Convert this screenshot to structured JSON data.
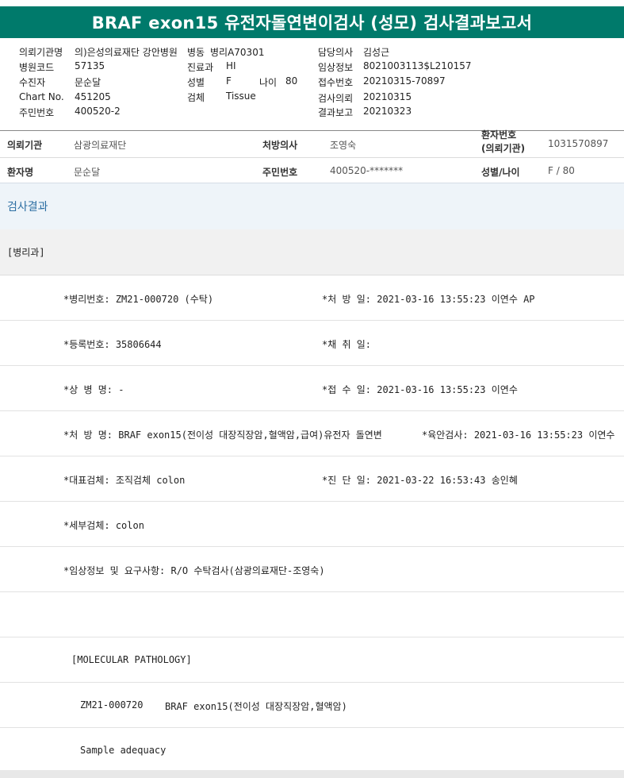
{
  "title": "BRAF exon15 유전자돌연변이검사 (성모) 검사결과보고서",
  "header": {
    "req_org_label": "의뢰기관명",
    "req_org_value": "의)은성의료재단 강안병원",
    "ward_label": "병동",
    "ward_value": "병리A70301",
    "doctor_label": "담당의사",
    "doctor_value": "김성근",
    "hosp_code_label": "병원코드",
    "hosp_code_value": "57135",
    "dept_label": "진료과",
    "dept_value": "HI",
    "clinical_label": "임상정보",
    "clinical_value": "8021003113$L210157",
    "patient_label": "수진자",
    "patient_value": "문순달",
    "sex_label": "성별",
    "sex_value": "F",
    "age_label": "나이",
    "age_value": "80",
    "receipt_label": "접수번호",
    "receipt_value": "20210315-70897",
    "chart_label": "Chart No.",
    "chart_value": "451205",
    "specimen_label": "검체",
    "specimen_value": "Tissue",
    "test_req_label": "검사의뢰",
    "test_req_value": "20210315",
    "id_label": "주민번호",
    "id_value": "400520-2",
    "report_label": "결과보고",
    "report_value": "20210323"
  },
  "info": {
    "org_label": "의뢰기관",
    "org_value": "삼광의료재단",
    "presc_label": "처방의사",
    "presc_value": "조영숙",
    "patno_label_1": "환자번호",
    "patno_label_2": "(의뢰기관)",
    "patno_value": "1031570897",
    "name_label": "환자명",
    "name_value": "문순달",
    "id_label": "주민번호",
    "id_value": "400520-*******",
    "sexage_label": "성별/나이",
    "sexage_value": "F / 80"
  },
  "section_title": "검사결과",
  "department": "[병리과]",
  "result_lines": {
    "path_no": "*병리번호: ZM21-000720 (수탁)",
    "presc_date": "*처 방 일: 2021-03-16 13:55:23  이연수 AP",
    "reg_no": "*등록번호: 35806644",
    "collect_date": "*채 취 일:",
    "disease": "*상 병 명: -",
    "receipt_date": "*접 수 일: 2021-03-16 13:55:23  이연수",
    "presc_name": "*처 방 명: BRAF exon15(전이성 대장직장암,혈액암,급여)유전자 돌연변",
    "gross_exam": "*육안검사: 2021-03-16 13:55:23  이연수",
    "rep_specimen": "*대표검체: 조직검체 colon",
    "diag_date": "*진 단 일: 2021-03-22 16:53:43  송인혜",
    "sub_specimen": "*세부검체: colon",
    "clinical_req": "*임상정보 및 요구사항: R/O 수탁검사(삼광의료재단-조영숙)",
    "mol_path": "[MOLECULAR PATHOLOGY]",
    "mol_code": "ZM21-000720",
    "mol_test": "BRAF exon15(전이성 대장직장암,혈액암)",
    "sample_adequacy": "Sample adequacy"
  }
}
